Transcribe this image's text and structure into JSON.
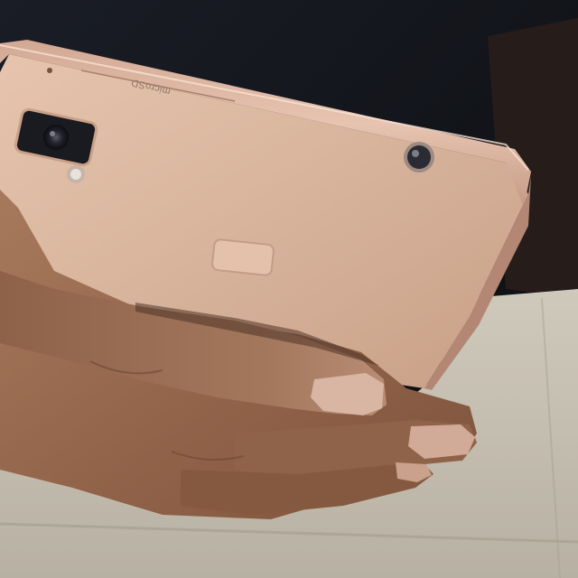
{
  "photo": {
    "subject": "smartphone-back-held-in-hand",
    "printed_text": {
      "sim_tray_label": "microSD"
    },
    "colors": {
      "background_dark": "#14161c",
      "phone_body_gold": "#d9b49c",
      "phone_edge": "#cfa48f",
      "skin": "#9c6e52",
      "floor_tile": "#c9c2b4"
    }
  }
}
